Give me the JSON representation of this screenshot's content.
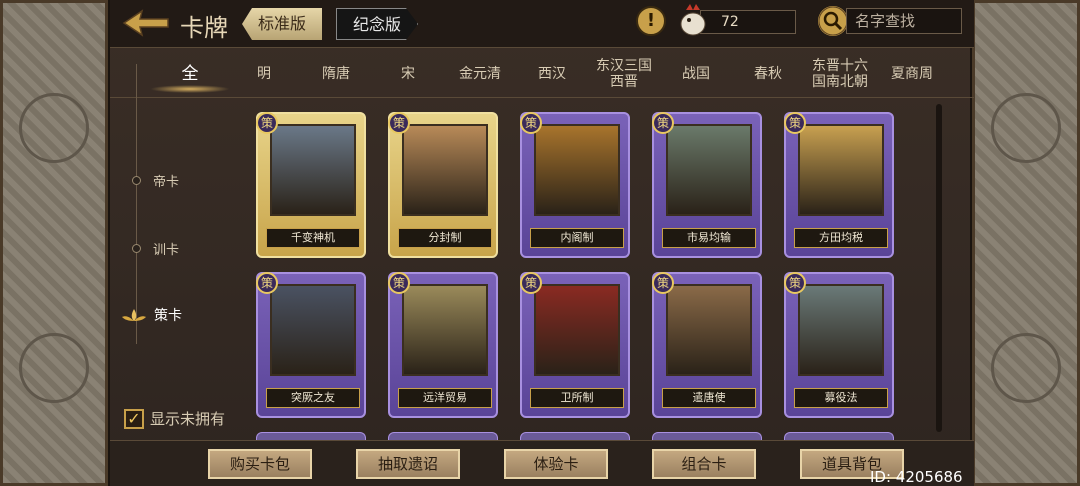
{
  "header": {
    "title": "卡牌",
    "version_tabs": [
      "标准版",
      "纪念版"
    ],
    "coins": "72",
    "search_placeholder": "名字查找"
  },
  "eras": [
    {
      "label": "全",
      "active": true
    },
    {
      "label": "明"
    },
    {
      "label": "隋唐"
    },
    {
      "label": "宋"
    },
    {
      "label": "金元清"
    },
    {
      "label": "西汉"
    },
    {
      "label": "东汉三国\n西晋"
    },
    {
      "label": "战国"
    },
    {
      "label": "春秋"
    },
    {
      "label": "东晋十六\n国南北朝"
    },
    {
      "label": "夏商周"
    }
  ],
  "categories": [
    {
      "label": "帝卡"
    },
    {
      "label": "训卡"
    },
    {
      "label": "策卡",
      "active": true
    }
  ],
  "show_unowned": {
    "label": "显示未拥有",
    "checked": true
  },
  "cards": [
    {
      "badge": "策",
      "name": "千变神机",
      "frame": "gold",
      "art_color": "#6a7888"
    },
    {
      "badge": "策",
      "name": "分封制",
      "frame": "gold",
      "art_color": "#b88a58"
    },
    {
      "badge": "策",
      "name": "内阁制",
      "frame": "purple",
      "art_color": "#a8742c"
    },
    {
      "badge": "策",
      "name": "市易均输",
      "frame": "purple",
      "art_color": "#6a7a6a"
    },
    {
      "badge": "策",
      "name": "方田均税",
      "frame": "purple",
      "art_color": "#c8a050"
    },
    {
      "badge": "策",
      "name": "突厥之友",
      "frame": "purple",
      "art_color": "#4a5262"
    },
    {
      "badge": "策",
      "name": "远洋贸易",
      "frame": "purple",
      "art_color": "#9a8a5a"
    },
    {
      "badge": "策",
      "name": "卫所制",
      "frame": "purple",
      "art_color": "#8a2a22"
    },
    {
      "badge": "策",
      "name": "遣唐使",
      "frame": "purple",
      "art_color": "#8a6a48"
    },
    {
      "badge": "策",
      "name": "募役法",
      "frame": "purple",
      "art_color": "#6a7a78"
    }
  ],
  "buttons": [
    "购买卡包",
    "抽取遗诏",
    "体验卡",
    "组合卡",
    "道具背包"
  ],
  "id_text": "ID: 4205686",
  "colors": {
    "gold_frame": "#c8a44a",
    "purple_frame": "#5a4498",
    "accent": "#c8a04a"
  }
}
